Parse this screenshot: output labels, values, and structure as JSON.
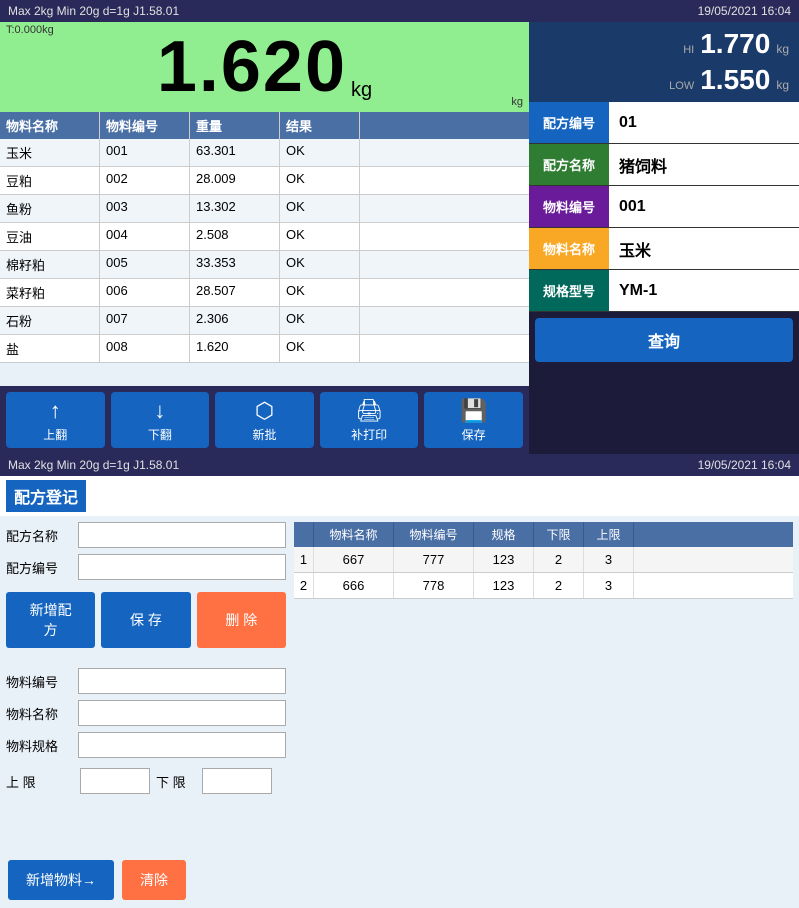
{
  "top_header": {
    "specs": "Max 2kg  Min 20g  d=1g  J1.58.01",
    "datetime": "19/05/2021  16:04"
  },
  "weight_display": {
    "value": "1.620",
    "unit": "kg",
    "tare": "T:0.000kg"
  },
  "hi_value": "1.770",
  "hi_label": "HI",
  "low_value": "1.550",
  "low_label": "LOW",
  "table": {
    "headers": [
      "物料名称",
      "物料编号",
      "重量",
      "结果"
    ],
    "rows": [
      {
        "name": "玉米",
        "code": "001",
        "weight": "63.301",
        "result": "OK"
      },
      {
        "name": "豆粕",
        "code": "002",
        "weight": "28.009",
        "result": "OK"
      },
      {
        "name": "鱼粉",
        "code": "003",
        "weight": "13.302",
        "result": "OK"
      },
      {
        "name": "豆油",
        "code": "004",
        "weight": "2.508",
        "result": "OK"
      },
      {
        "name": "棉籽粕",
        "code": "005",
        "weight": "33.353",
        "result": "OK"
      },
      {
        "name": "菜籽粕",
        "code": "006",
        "weight": "28.507",
        "result": "OK"
      },
      {
        "name": "石粉",
        "code": "007",
        "weight": "2.306",
        "result": "OK"
      },
      {
        "name": "盐",
        "code": "008",
        "weight": "1.620",
        "result": "OK"
      }
    ]
  },
  "action_buttons": [
    {
      "label": "上翻",
      "icon": "↑"
    },
    {
      "label": "下翻",
      "icon": "↓"
    },
    {
      "label": "新批",
      "icon": "⬡"
    },
    {
      "label": "补打印",
      "icon": "🖨"
    },
    {
      "label": "保存",
      "icon": "💾"
    }
  ],
  "right_info": [
    {
      "label": "配方编号",
      "value": "01",
      "color": "#1565c0"
    },
    {
      "label": "配方名称",
      "value": "猪饲料",
      "color": "#2e7d32"
    },
    {
      "label": "物料编号",
      "value": "001",
      "color": "#6a1b9a"
    },
    {
      "label": "物料名称",
      "value": "玉米",
      "color": "#f9a825"
    },
    {
      "label": "规格型号",
      "value": "YM-1",
      "color": "#00695c"
    }
  ],
  "query_button": "查询",
  "bottom_header": {
    "specs": "Max 2kg  Min 20g  d=1g  J1.58.01",
    "datetime": "19/05/2021  16:04"
  },
  "bottom_title": "配方登记",
  "form": {
    "formula_name_label": "配方名称",
    "formula_code_label": "配方编号",
    "material_code_label": "物料编号",
    "material_name_label": "物料名称",
    "material_spec_label": "物料规格",
    "upper_limit_label": "上  限",
    "lower_limit_label": "下  限"
  },
  "form_buttons": {
    "new": "新增配方",
    "save": "保   存",
    "delete": "删   除"
  },
  "right_table": {
    "headers": [
      "",
      "物料名称",
      "物料编号",
      "规格",
      "下限",
      "上限"
    ],
    "rows": [
      {
        "seq": "1",
        "name": "667",
        "code": "777",
        "spec": "123",
        "lower": "2",
        "upper": "3"
      },
      {
        "seq": "2",
        "name": "666",
        "code": "778",
        "spec": "123",
        "lower": "2",
        "upper": "3"
      }
    ]
  },
  "bottom_buttons": {
    "add_material": "新增物料→",
    "clear": "清除"
  }
}
